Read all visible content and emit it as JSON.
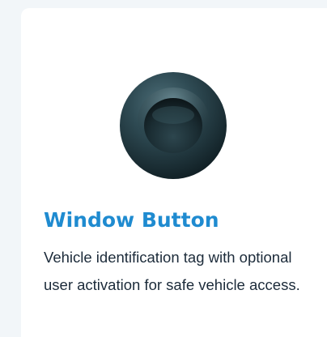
{
  "card": {
    "image_icon": "round-black-button-photo",
    "title": "Window Button",
    "description": "Vehicle identification tag with optional user activation for safe vehicle access."
  },
  "colors": {
    "title": "#1f8bd0",
    "description": "#1c2b3a",
    "card_background": "#ffffff",
    "page_background": "#f2f6f9"
  }
}
